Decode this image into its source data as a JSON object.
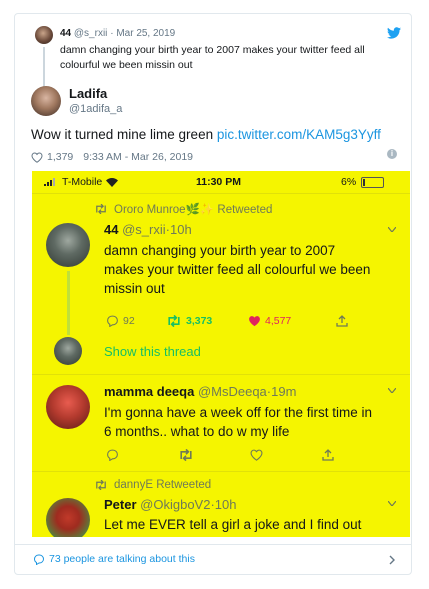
{
  "quoted": {
    "name": "44",
    "handle": "@s_rxii",
    "date": "Mar 25, 2019",
    "text": "damn changing your birth year to 2007 makes your twitter feed all colourful we been missin out"
  },
  "main": {
    "name": "Ladifa",
    "handle": "@1adifa_a",
    "text": "Wow it turned mine lime green",
    "link": "pic.twitter.com/KAM5g3Yyff",
    "likes": "1,379",
    "timestamp": "9:33 AM - Mar 26, 2019"
  },
  "screenshot": {
    "background": "#f5f500",
    "status": {
      "carrier": "T-Mobile",
      "time": "11:30 PM",
      "battery": "6%"
    },
    "tweets": [
      {
        "retweeted_by": "Ororo Munroe🌿✨ Retweeted",
        "name": "44",
        "handle": "@s_rxii",
        "age": "10h",
        "text": "damn changing your birth year to 2007 makes your twitter feed all colourful we been missin out",
        "replies": "92",
        "retweets": "3,373",
        "likes": "4,577",
        "show_thread": "Show this thread"
      },
      {
        "name": "mamma deeqa",
        "handle": "@MsDeeqa",
        "age": "19m",
        "text": "I'm gonna have a week off for the first time in 6 months.. what to do w my life"
      },
      {
        "retweeted_by": "dannyE Retweeted",
        "name": "Peter",
        "handle": "@OkigboV2",
        "age": "10h",
        "text": "Let me EVER tell a girl a joke and I find out her laugh sounds like a dental drill."
      }
    ]
  },
  "footer": {
    "talking": "73 people are talking about this"
  },
  "colors": {
    "link": "#1b95e0",
    "retweet_green": "#17bf63",
    "like_red": "#e0245e",
    "highlight": "#f5f500"
  }
}
